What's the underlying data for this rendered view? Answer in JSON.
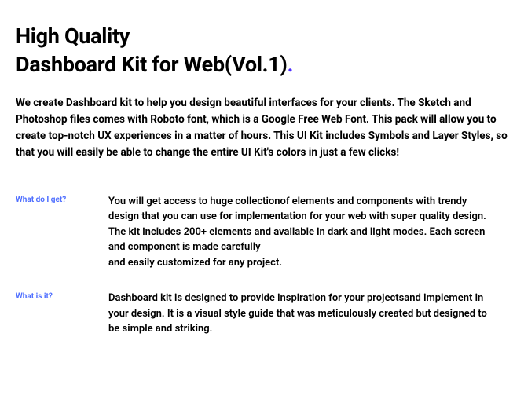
{
  "heading": {
    "line1": "High Quality",
    "line2": "Dashboard Kit for Web(Vol.1)",
    "dot": "."
  },
  "subheadline": "We create Dashboard kit to help you design beautiful interfaces for your clients. The Sketch and Photoshop files comes with Roboto font, which is a Google Free Web Font. This pack will allow you to create top-notch UX experiences in a matter of hours. This UI Kit includes Symbols and Layer Styles, so that you will easily be able to change the entire UI Kit's colors in just a few clicks!",
  "sections": [
    {
      "label": "What do I get?",
      "body": "You will get access to huge collectionof elements  and components with trendy design that  you can use for implementation for your web with super quality design. The kit includes 200+ elements and available in dark and light modes.  Each screen and component is made carefully\nand easily customized for any project."
    },
    {
      "label": "What is it?",
      "body": "Dashboard  kit is designed to provide inspiration for  your projectsand implement in your design. It is a visual style guide that was meticulously created but designed to\nbe simple and striking."
    }
  ]
}
